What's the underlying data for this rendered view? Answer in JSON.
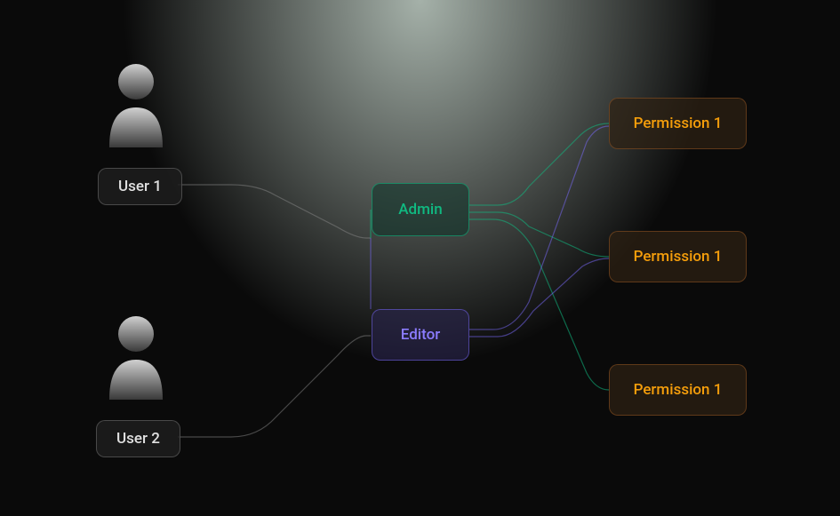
{
  "users": [
    {
      "label": "User 1"
    },
    {
      "label": "User 2"
    }
  ],
  "roles": [
    {
      "label": "Admin"
    },
    {
      "label": "Editor"
    }
  ],
  "permissions": [
    {
      "label": "Permission 1"
    },
    {
      "label": "Permission 1"
    },
    {
      "label": "Permission 1"
    }
  ],
  "colors": {
    "user_stroke": "#888888",
    "admin_stroke": "#10b981",
    "editor_stroke": "#8b7cff",
    "permission_stroke": "#f59e0b"
  }
}
